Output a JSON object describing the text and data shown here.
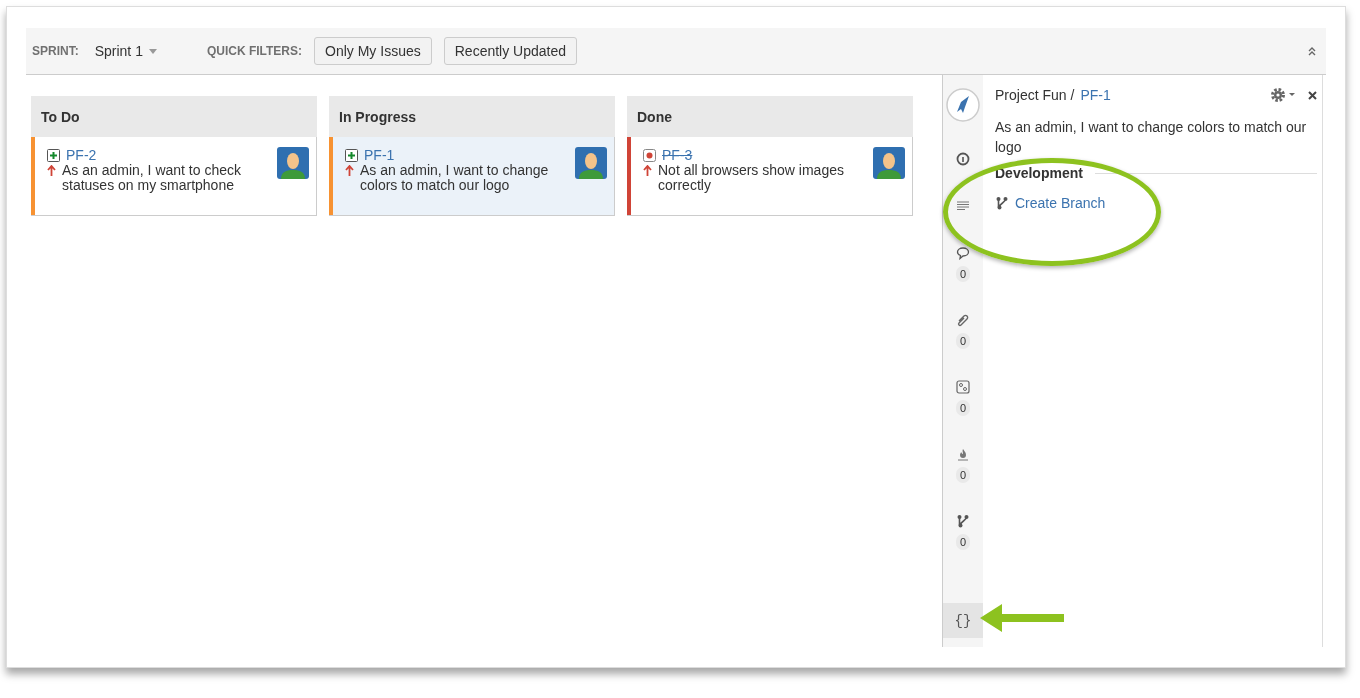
{
  "toolbar": {
    "sprint_label": "SPRINT:",
    "sprint": "Sprint 1",
    "quick_filters_label": "QUICK FILTERS:",
    "filters": [
      {
        "label": "Only My Issues",
        "selected": false
      },
      {
        "label": "Recently Updated",
        "selected": false
      }
    ]
  },
  "columns": [
    {
      "title": "To Do",
      "cards": [
        {
          "key": "PF-2",
          "kind": "story",
          "summary": "As an admin, I want to check statuses on my smartphone",
          "selected": false,
          "resolved": false,
          "color": "#f79232"
        }
      ]
    },
    {
      "title": "In Progress",
      "cards": [
        {
          "key": "PF-1",
          "kind": "story",
          "summary": "As an admin, I want to change colors to match our logo",
          "selected": true,
          "resolved": false,
          "color": "#f79232"
        }
      ]
    },
    {
      "title": "Done",
      "cards": [
        {
          "key": "PF-3",
          "kind": "bug",
          "summary": "Not all browsers show images correctly",
          "selected": false,
          "resolved": true,
          "color": "#d04437"
        }
      ]
    }
  ],
  "detail": {
    "project": "Project Fun /",
    "issue_key": "PF-1",
    "summary": "As an admin, I want to change colors to match our logo",
    "section_title": "Development",
    "action": "Create Branch",
    "nav": [
      {
        "kind": "info"
      },
      {
        "kind": "description"
      },
      {
        "kind": "comments",
        "count": "0"
      },
      {
        "kind": "attachments",
        "count": "0"
      },
      {
        "kind": "subtasks",
        "count": "0"
      },
      {
        "kind": "activity",
        "count": "0"
      },
      {
        "kind": "branches",
        "count": "0"
      },
      {
        "kind": "code",
        "glyph": "{}",
        "selected": true
      }
    ]
  }
}
